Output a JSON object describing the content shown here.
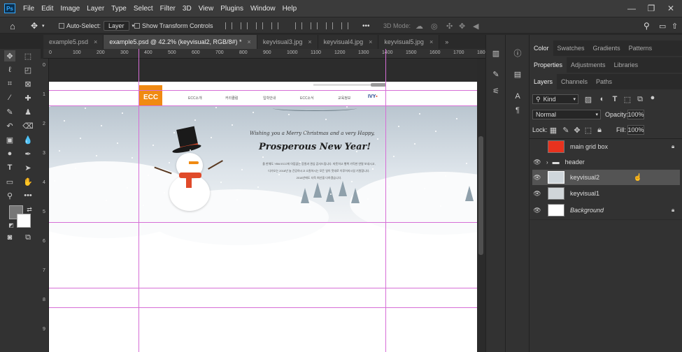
{
  "menubar": {
    "logo": "Ps",
    "items": [
      "File",
      "Edit",
      "Image",
      "Layer",
      "Type",
      "Select",
      "Filter",
      "3D",
      "View",
      "Plugins",
      "Window",
      "Help"
    ],
    "minimize": "—",
    "maximize": "❐",
    "close": "✕"
  },
  "options": {
    "auto_select_label": "Auto-Select:",
    "auto_select_value": "Layer",
    "show_transform_label": "Show Transform Controls",
    "mode_3d": "3D Mode:",
    "more": "•••"
  },
  "tabs": [
    {
      "label": "example5.psd",
      "active": false
    },
    {
      "label": "example5.psd @ 42.2% (keyvisual2, RGB/8#) *",
      "active": true
    },
    {
      "label": "keyvisual3.jpg",
      "active": false
    },
    {
      "label": "keyvisual4.jpg",
      "active": false
    },
    {
      "label": "keyvisual5.jpg",
      "active": false
    }
  ],
  "tab_close": "×",
  "more_tabs": "»",
  "ruler": {
    "h_ticks": [
      "0",
      "100",
      "200",
      "300",
      "400",
      "500",
      "600",
      "700",
      "800",
      "900",
      "1000",
      "1100",
      "1200",
      "1300",
      "1400",
      "1500",
      "1600",
      "1700",
      "1800"
    ],
    "v_ticks": [
      "0",
      "1",
      "2",
      "3",
      "4",
      "5",
      "6",
      "7",
      "8",
      "9"
    ]
  },
  "site": {
    "logo": "ECC",
    "nav": [
      "ECC소개",
      "커리큘럼",
      "입학안내",
      "ECC소식",
      "교육정보"
    ],
    "hero_line1": "Wishing you a Merry Christmas and a very Happy,",
    "hero_line2": "Prosperous New Year!",
    "hero_p1": "올 한해도 YBM ECC에 아낌없는 응원과 관심 감사드립니다. 따뜻하고 행복 가득한 연말 보내시고,",
    "hero_p2": "다가오는 2018년 늘 건강하시고 소원하시는 모든 일이 뜻대로 이루어지시길 기원합니다.",
    "hero_p3": "2018년에도 더욱 최선을 다하겠습니다."
  },
  "panels": {
    "row1": [
      "Color",
      "Swatches",
      "Gradients",
      "Patterns"
    ],
    "row2": [
      "Properties",
      "Adjustments",
      "Libraries"
    ],
    "row3": [
      "Layers",
      "Channels",
      "Paths"
    ],
    "filter_kind": "Kind",
    "blend_mode": "Normal",
    "opacity_label": "Opacity:",
    "opacity_value": "100%",
    "lock_label": "Lock:",
    "fill_label": "Fill:",
    "fill_value": "100%"
  },
  "layers": [
    {
      "name": "main grid box",
      "visible": false,
      "locked": true,
      "thumb": "#e8321e"
    },
    {
      "name": "header",
      "visible": true,
      "locked": false,
      "folder": true
    },
    {
      "name": "keyvisual2",
      "visible": true,
      "locked": false,
      "selected": true
    },
    {
      "name": "keyvisual1",
      "visible": true,
      "locked": false
    },
    {
      "name": "Background",
      "visible": true,
      "locked": true,
      "thumb": "#ffffff"
    }
  ],
  "colors": {
    "accent_guide": "#d66ed6",
    "logo_orange": "#f08a12",
    "scarf_red": "#e04a2a",
    "ps_blue": "#31a8ff"
  }
}
